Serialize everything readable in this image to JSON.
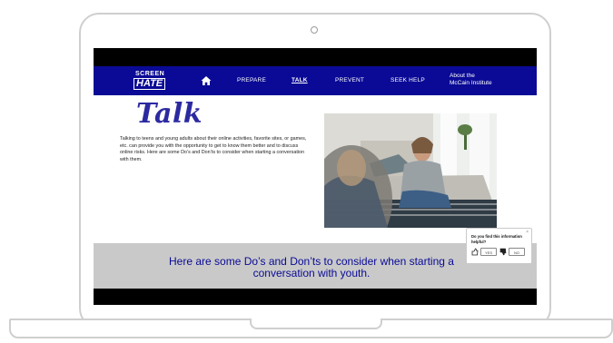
{
  "nav": {
    "logo_top": "SCREEN",
    "logo_bottom": "HATE",
    "items": [
      {
        "label": "PREPARE"
      },
      {
        "label": "TALK"
      },
      {
        "label": "PREVENT"
      },
      {
        "label": "SEEK HELP"
      }
    ],
    "about_line1": "About the",
    "about_line2": "McCain Institute"
  },
  "main": {
    "title": "Talk",
    "paragraph": "Talking to teens and young adults about their online activities, favorite sites, or games, etc. can provide you with the opportunity to get to know them better and to discuss online risks. Here are some Do’s and Don’ts to consider when starting a conversation with them.",
    "banner": "Here are some Do’s and Don’ts to consider when starting a conversation with youth."
  },
  "feedback": {
    "question": "Do you find this information helpful?",
    "yes": "YES",
    "no": "NO",
    "close": "×"
  },
  "colors": {
    "nav_bg": "#0a0a96",
    "title": "#2c2aa0",
    "banner_bg": "#c9c9c9"
  }
}
